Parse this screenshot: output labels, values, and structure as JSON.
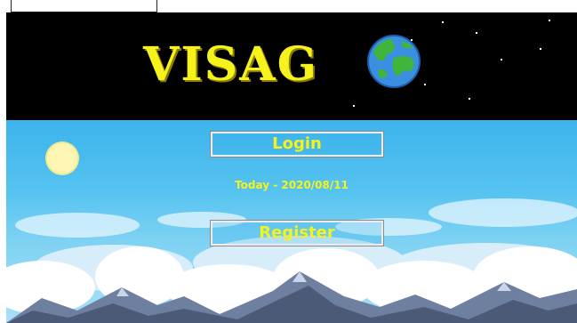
{
  "game": {
    "title": "VISAG"
  },
  "menu": {
    "login_label": "Login",
    "register_label": "Register"
  },
  "date_text": "Today - 2020/08/11",
  "colors": {
    "title": "#f6f21c",
    "space": "#000000",
    "sky": "#3cb4ec",
    "button_text": "#f6f21c"
  },
  "icons": {
    "planet": "earth-icon",
    "sun": "sun-icon"
  }
}
